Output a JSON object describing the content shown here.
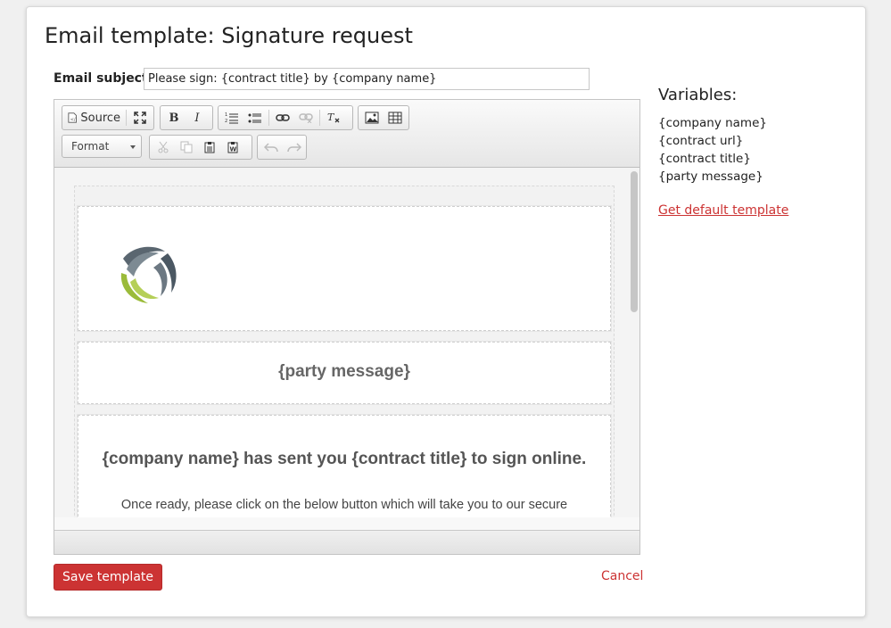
{
  "page": {
    "title": "Email template: Signature request"
  },
  "subject": {
    "label": "Email subject:",
    "value": "Please sign: {contract title} by {company name}"
  },
  "toolbar": {
    "source_label": "Source",
    "format_label": "Format",
    "icons": [
      "source-icon",
      "maximize-icon",
      "bold-icon",
      "italic-icon",
      "numbered-list-icon",
      "bulleted-list-icon",
      "link-icon",
      "unlink-icon",
      "remove-format-icon",
      "image-icon",
      "table-icon",
      "cut-icon",
      "copy-icon",
      "paste-icon",
      "paste-word-icon",
      "undo-icon",
      "redo-icon"
    ]
  },
  "editor_content": {
    "party_message": "{party message}",
    "headline": "{company name} has sent you {contract title} to sign online.",
    "body_text": "Once ready, please click on the below button which will take you to our secure"
  },
  "variables": {
    "title": "Variables:",
    "items": [
      "{company name}",
      "{contract url}",
      "{contract title}",
      "{party message}"
    ]
  },
  "links": {
    "default_template": "Get default template",
    "cancel": "Cancel"
  },
  "actions": {
    "save_label": "Save template"
  },
  "colors": {
    "accent": "#cc3333",
    "logo_gray": "#5a6670",
    "logo_green": "#9bbb3a"
  }
}
